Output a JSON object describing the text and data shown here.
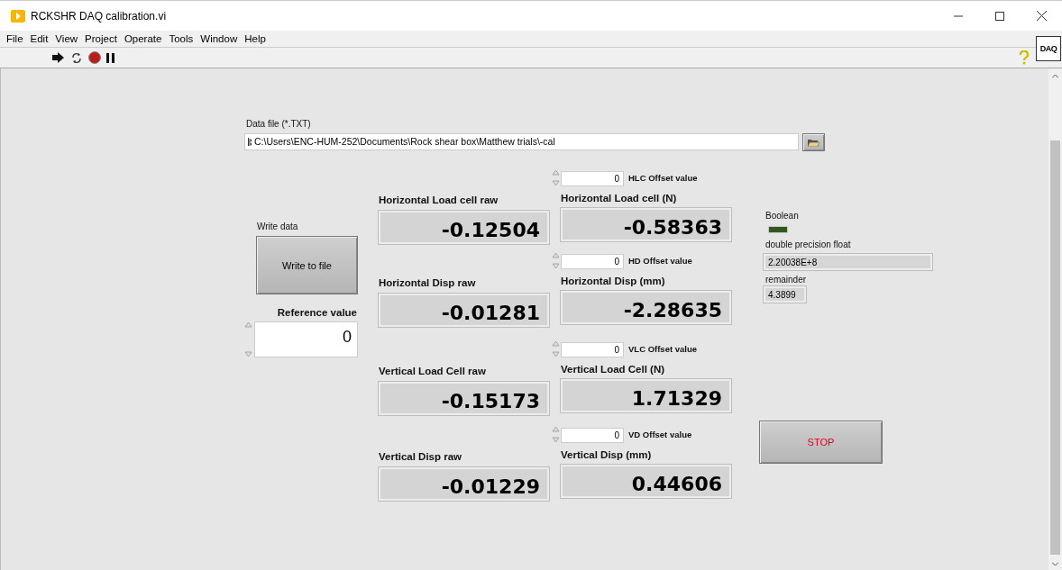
{
  "window": {
    "title": "RCKSHR DAQ calibration.vi"
  },
  "menu": [
    "File",
    "Edit",
    "View",
    "Project",
    "Operate",
    "Tools",
    "Window",
    "Help"
  ],
  "vi_icon": {
    "label": "DAQ"
  },
  "panel": {
    "data_file": {
      "label": "Data file  (*.TXT)",
      "value": "C:\\Users\\ENC-HUM-252\\Documents\\Rock shear box\\Matthew trials\\-cal"
    },
    "write_button": {
      "caption": "Write data",
      "label": "Write to file"
    },
    "reference": {
      "label": "Reference value",
      "value": "0"
    },
    "offsets": [
      {
        "label": "HLC Offset value",
        "value": "0"
      },
      {
        "label": "HD Offset value",
        "value": "0"
      },
      {
        "label": "VLC Offset value",
        "value": "0"
      },
      {
        "label": "VD Offset value",
        "value": "0"
      }
    ],
    "raw_indicators": [
      {
        "label": "Horizontal Load cell raw",
        "value": "-0.12504"
      },
      {
        "label": "Horizontal Disp raw",
        "value": "-0.01281"
      },
      {
        "label": "Vertical Load Cell raw",
        "value": "-0.15173"
      },
      {
        "label": "Vertical Disp raw",
        "value": "-0.01229"
      }
    ],
    "scaled_indicators": [
      {
        "label": "Horizontal Load cell (N)",
        "value": "-0.58363"
      },
      {
        "label": "Horizontal Disp (mm)",
        "value": "-2.28635"
      },
      {
        "label": "Vertical Load Cell (N)",
        "value": "1.71329"
      },
      {
        "label": "Vertical Disp (mm)",
        "value": "0.44606"
      }
    ],
    "boolean": {
      "label": "Boolean",
      "on": false
    },
    "double": {
      "label": "double precision float",
      "value": "2.20038E+8"
    },
    "remainder": {
      "label": "remainder",
      "value": "4.3899"
    },
    "stop_button": {
      "label": "STOP"
    }
  }
}
